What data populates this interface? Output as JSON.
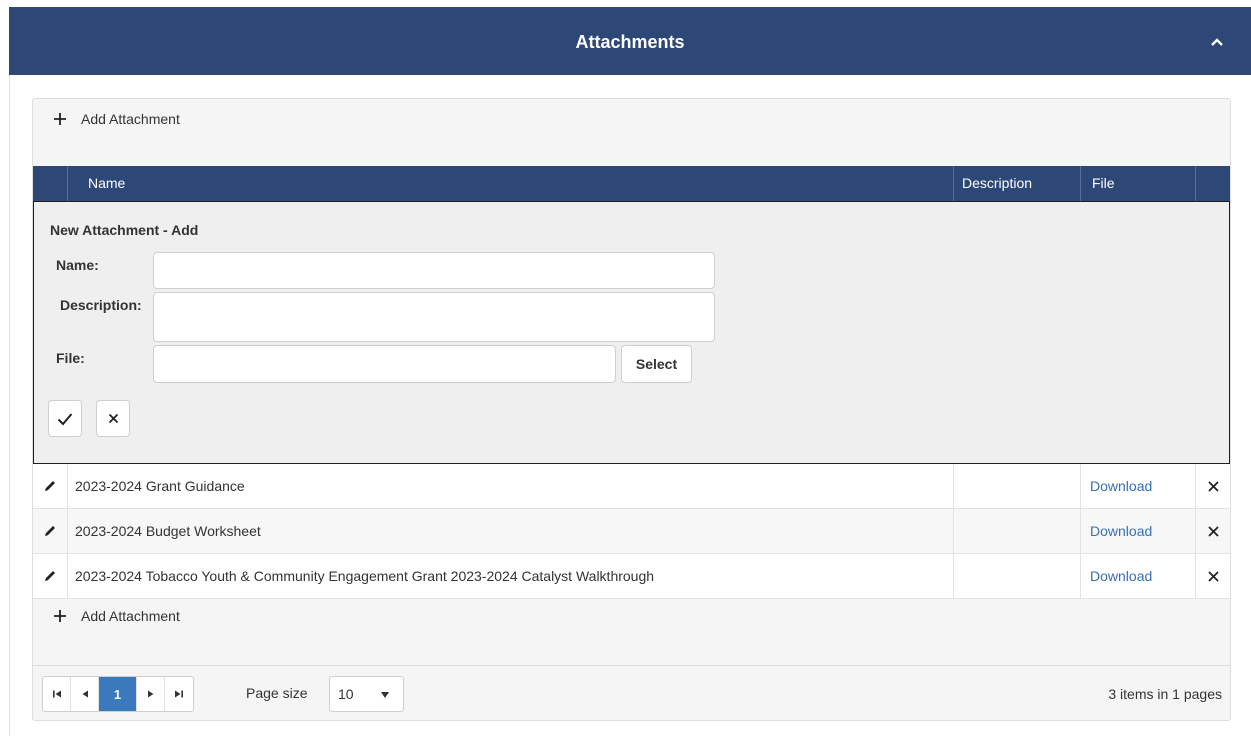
{
  "panel": {
    "title": "Attachments"
  },
  "toolbar": {
    "add_label": "Add Attachment"
  },
  "columns": {
    "name": "Name",
    "description": "Description",
    "file": "File"
  },
  "form": {
    "title": "New Attachment - Add",
    "name_label": "Name:",
    "description_label": "Description:",
    "file_label": "File:",
    "name_value": "",
    "description_value": "",
    "file_value": "",
    "select_label": "Select"
  },
  "rows": [
    {
      "name": "2023-2024 Grant Guidance",
      "description": "",
      "file_link": "Download"
    },
    {
      "name": "2023-2024 Budget Worksheet",
      "description": "",
      "file_link": "Download"
    },
    {
      "name": "2023-2024 Tobacco Youth & Community Engagement Grant 2023-2024 Catalyst Walkthrough",
      "description": "",
      "file_link": "Download"
    }
  ],
  "pager": {
    "current_page": "1",
    "page_size_label": "Page size",
    "page_size_value": "10",
    "info": "3 items in 1 pages"
  },
  "colors": {
    "header_bg": "#2d4777",
    "link": "#3a6fb0",
    "active_page": "#3b79bd"
  },
  "icons": {
    "collapse": "chevron-up-icon",
    "add": "plus-icon",
    "edit": "pencil-icon",
    "delete": "close-icon",
    "save": "check-icon",
    "cancel": "close-icon"
  }
}
